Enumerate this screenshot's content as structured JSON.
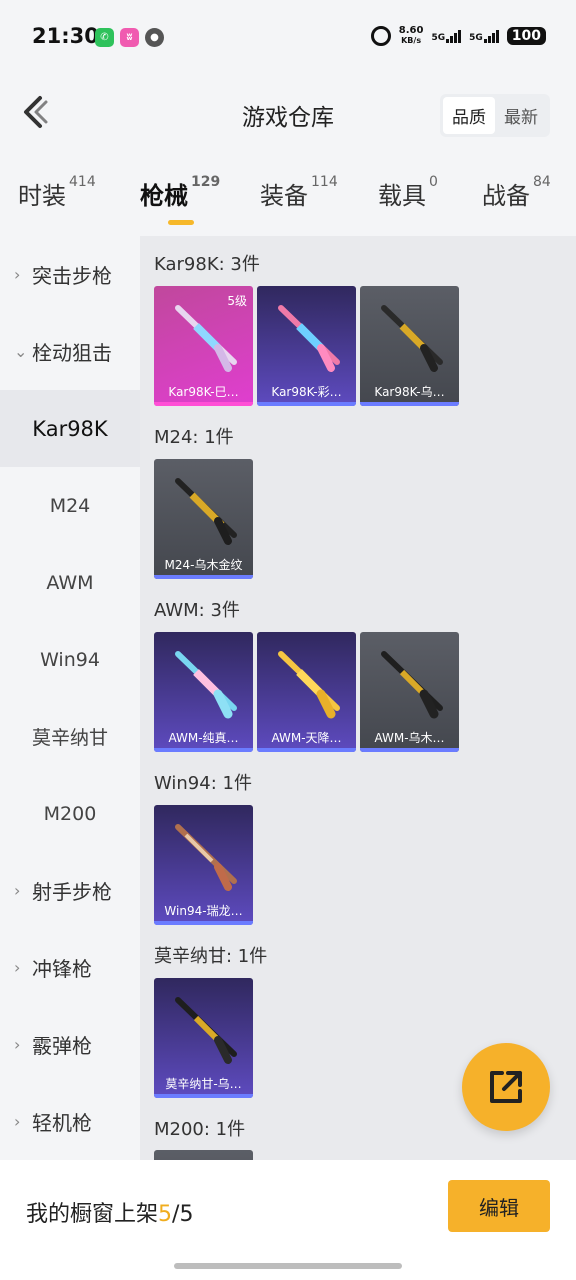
{
  "status_bar": {
    "time": "21:30",
    "net_speed_value": "8.60",
    "net_speed_unit": "KB/s",
    "sig1": "5G",
    "sig2": "5G",
    "battery": "100"
  },
  "header": {
    "title": "游戏仓库",
    "sort_options": [
      "品质",
      "最新"
    ]
  },
  "tabs": [
    {
      "label": "时装",
      "count": "414"
    },
    {
      "label": "枪械",
      "count": "129"
    },
    {
      "label": "装备",
      "count": "114"
    },
    {
      "label": "载具",
      "count": "0"
    },
    {
      "label": "战备",
      "count": "84"
    }
  ],
  "sidebar": [
    {
      "label": "突击步枪",
      "type": "cat",
      "chev": "›"
    },
    {
      "label": "栓动狙击",
      "type": "cat",
      "chev": "⌄"
    },
    {
      "label": "Kar98K",
      "type": "sub"
    },
    {
      "label": "M24",
      "type": "sub"
    },
    {
      "label": "AWM",
      "type": "sub"
    },
    {
      "label": "Win94",
      "type": "sub"
    },
    {
      "label": "莫辛纳甘",
      "type": "sub"
    },
    {
      "label": "M200",
      "type": "sub"
    },
    {
      "label": "射手步枪",
      "type": "cat",
      "chev": "›"
    },
    {
      "label": "冲锋枪",
      "type": "cat",
      "chev": "›"
    },
    {
      "label": "霰弹枪",
      "type": "cat",
      "chev": "›"
    },
    {
      "label": "轻机枪",
      "type": "cat",
      "chev": "›"
    }
  ],
  "groups": [
    {
      "title": "Kar98K: 3件",
      "items": [
        {
          "label": "Kar98K-巳…",
          "quality": "pink",
          "level": "5级"
        },
        {
          "label": "Kar98K-彩…",
          "quality": "purple"
        },
        {
          "label": "Kar98K-乌…",
          "quality": "gray"
        }
      ]
    },
    {
      "title": "M24: 1件",
      "items": [
        {
          "label": "M24-乌木金纹",
          "quality": "gray"
        }
      ]
    },
    {
      "title": "AWM: 3件",
      "items": [
        {
          "label": "AWM-纯真…",
          "quality": "purple"
        },
        {
          "label": "AWM-天降…",
          "quality": "purple"
        },
        {
          "label": "AWM-乌木…",
          "quality": "gray"
        }
      ]
    },
    {
      "title": "Win94: 1件",
      "items": [
        {
          "label": "Win94-瑞龙…",
          "quality": "purple"
        }
      ]
    },
    {
      "title": "莫辛纳甘: 1件",
      "items": [
        {
          "label": "莫辛纳甘-乌…",
          "quality": "purple"
        }
      ]
    },
    {
      "title": "M200: 1件",
      "items": [
        {
          "label": "",
          "quality": "gray"
        }
      ]
    }
  ],
  "bottom": {
    "showcase_label": "我的橱窗上架",
    "showcase_current": "5",
    "showcase_sep": "/",
    "showcase_total": "5",
    "edit_label": "编辑"
  },
  "colors": {
    "accent": "#f6b12a",
    "quality_pink": "#e03ed0",
    "quality_purple": "#5e4bc0",
    "quality_gray": "#4a4d54"
  }
}
